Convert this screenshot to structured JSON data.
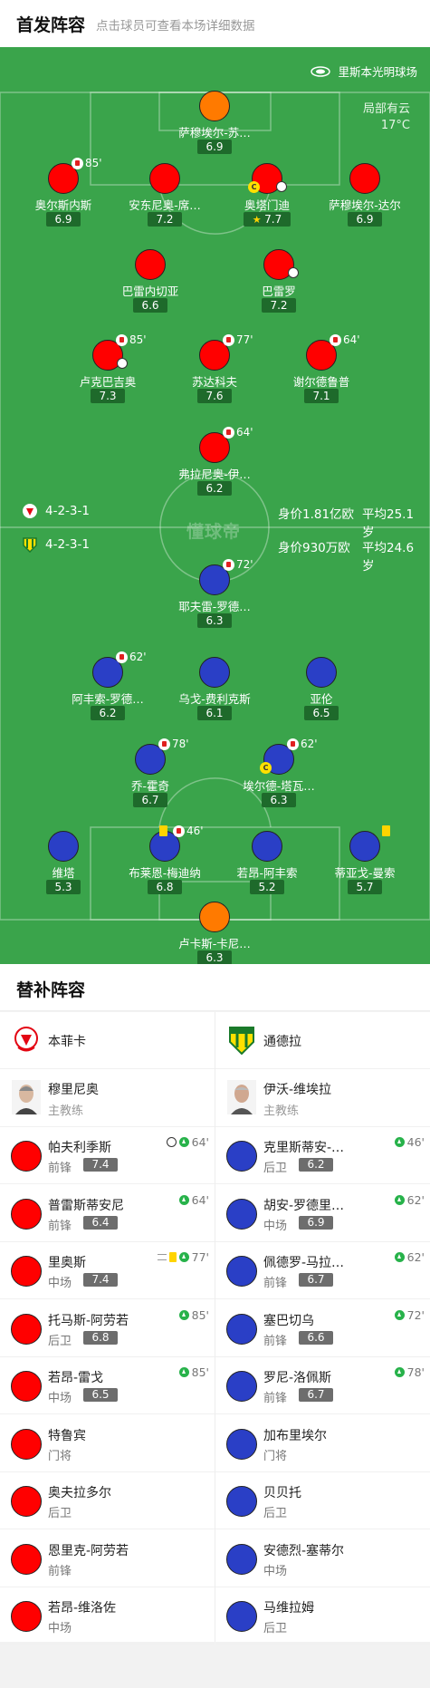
{
  "header": {
    "title": "首发阵容",
    "subtitle": "点击球员可查看本场详细数据"
  },
  "pitch": {
    "venue": "里斯本光明球场",
    "weather": "局部有云",
    "temperature": "17°C",
    "watermark": "懂球帝",
    "home_info": {
      "formation": "4-2-3-1",
      "value": "身价1.81亿欧",
      "avg_age": "平均25.1岁"
    },
    "away_info": {
      "formation": "4-2-3-1",
      "value": "身价930万欧",
      "avg_age": "平均24.6岁"
    }
  },
  "chart_data": {
    "type": "table",
    "home_lineup": [
      {
        "name": "萨穆埃尔-苏…",
        "rating": "6.9",
        "kit": "orange",
        "sub": "",
        "captain": false,
        "ball": false,
        "star": false,
        "card": false
      },
      {
        "name": "奥尔斯内斯",
        "rating": "6.9",
        "kit": "red",
        "sub": "85'",
        "captain": false,
        "ball": false,
        "star": false,
        "card": false
      },
      {
        "name": "安东尼奥-席…",
        "rating": "7.2",
        "kit": "red",
        "sub": "",
        "captain": false,
        "ball": false,
        "star": false,
        "card": false
      },
      {
        "name": "奥塔门迪",
        "rating": "7.7",
        "kit": "red",
        "sub": "",
        "captain": true,
        "ball": true,
        "star": true,
        "card": false
      },
      {
        "name": "萨穆埃尔-达尔",
        "rating": "6.9",
        "kit": "red",
        "sub": "",
        "captain": false,
        "ball": false,
        "star": false,
        "card": false
      },
      {
        "name": "巴雷内切亚",
        "rating": "6.6",
        "kit": "red",
        "sub": "",
        "captain": false,
        "ball": false,
        "star": false,
        "card": false
      },
      {
        "name": "巴雷罗",
        "rating": "7.2",
        "kit": "red",
        "sub": "",
        "captain": false,
        "ball": true,
        "star": false,
        "card": false
      },
      {
        "name": "卢克巴吉奥",
        "rating": "7.3",
        "kit": "red",
        "sub": "85'",
        "captain": false,
        "ball": true,
        "star": false,
        "card": false
      },
      {
        "name": "苏达科夫",
        "rating": "7.6",
        "kit": "red",
        "sub": "77'",
        "captain": false,
        "ball": false,
        "star": false,
        "card": false
      },
      {
        "name": "谢尔德鲁普",
        "rating": "7.1",
        "kit": "red",
        "sub": "64'",
        "captain": false,
        "ball": false,
        "star": false,
        "card": false
      },
      {
        "name": "弗拉尼奥-伊…",
        "rating": "6.2",
        "kit": "red",
        "sub": "64'",
        "captain": false,
        "ball": false,
        "star": false,
        "card": false
      }
    ],
    "away_lineup": [
      {
        "name": "耶夫雷-罗德…",
        "rating": "6.3",
        "kit": "blue",
        "sub": "72'",
        "captain": false,
        "ball": false,
        "star": false,
        "card": false
      },
      {
        "name": "阿丰索-罗德…",
        "rating": "6.2",
        "kit": "blue",
        "sub": "62'",
        "captain": false,
        "ball": false,
        "star": false,
        "card": false
      },
      {
        "name": "乌戈-费利克斯",
        "rating": "6.1",
        "kit": "blue",
        "sub": "",
        "captain": false,
        "ball": false,
        "star": false,
        "card": false
      },
      {
        "name": "亚伦",
        "rating": "6.5",
        "kit": "blue",
        "sub": "",
        "captain": false,
        "ball": false,
        "star": false,
        "card": false
      },
      {
        "name": "乔-霍奇",
        "rating": "6.7",
        "kit": "blue",
        "sub": "78'",
        "captain": false,
        "ball": false,
        "star": false,
        "card": false
      },
      {
        "name": "埃尔德-塔瓦…",
        "rating": "6.3",
        "kit": "blue",
        "sub": "62'",
        "captain": true,
        "ball": false,
        "star": false,
        "card": false
      },
      {
        "name": "维塔",
        "rating": "5.3",
        "kit": "blue",
        "sub": "",
        "captain": false,
        "ball": false,
        "star": false,
        "card": false
      },
      {
        "name": "布莱恩-梅迪纳",
        "rating": "6.8",
        "kit": "blue",
        "sub": "46'",
        "captain": false,
        "ball": false,
        "star": false,
        "card": true
      },
      {
        "name": "若昂-阿丰索",
        "rating": "5.2",
        "kit": "blue",
        "sub": "",
        "captain": false,
        "ball": false,
        "star": false,
        "card": false
      },
      {
        "name": "蒂亚戈-曼索",
        "rating": "5.7",
        "kit": "blue",
        "sub": "",
        "captain": false,
        "ball": false,
        "star": false,
        "card": true
      },
      {
        "name": "卢卡斯-卡尼…",
        "rating": "6.3",
        "kit": "orange",
        "sub": "",
        "captain": false,
        "ball": false,
        "star": false,
        "card": false
      }
    ]
  },
  "subs": {
    "title": "替补阵容",
    "home": {
      "team": "本菲卡",
      "coach": {
        "name": "穆里尼奥",
        "role": "主教练"
      },
      "players": [
        {
          "name": "帕夫利季斯",
          "pos": "前锋",
          "rating": "7.4",
          "time": "64'",
          "ball": true,
          "card": false,
          "swap": false
        },
        {
          "name": "普雷斯蒂安尼",
          "pos": "前锋",
          "rating": "6.4",
          "time": "64'",
          "ball": false,
          "card": false,
          "swap": false
        },
        {
          "name": "里奥斯",
          "pos": "中场",
          "rating": "7.4",
          "time": "77'",
          "ball": false,
          "card": true,
          "swap": true
        },
        {
          "name": "托马斯-阿劳若",
          "pos": "后卫",
          "rating": "6.8",
          "time": "85'",
          "ball": false,
          "card": false,
          "swap": false
        },
        {
          "name": "若昂-雷戈",
          "pos": "中场",
          "rating": "6.5",
          "time": "85'",
          "ball": false,
          "card": false,
          "swap": false
        },
        {
          "name": "特鲁宾",
          "pos": "门将",
          "rating": "",
          "time": "",
          "ball": false,
          "card": false,
          "swap": false
        },
        {
          "name": "奥夫拉多尔",
          "pos": "后卫",
          "rating": "",
          "time": "",
          "ball": false,
          "card": false,
          "swap": false
        },
        {
          "name": "恩里克-阿劳若",
          "pos": "前锋",
          "rating": "",
          "time": "",
          "ball": false,
          "card": false,
          "swap": false
        },
        {
          "name": "若昂-维洛佐",
          "pos": "中场",
          "rating": "",
          "time": "",
          "ball": false,
          "card": false,
          "swap": false
        }
      ]
    },
    "away": {
      "team": "通德拉",
      "coach": {
        "name": "伊沃-维埃拉",
        "role": "主教练"
      },
      "players": [
        {
          "name": "克里斯蒂安-…",
          "pos": "后卫",
          "rating": "6.2",
          "time": "46'",
          "ball": false,
          "card": false,
          "swap": false
        },
        {
          "name": "胡安-罗德里…",
          "pos": "中场",
          "rating": "6.9",
          "time": "62'",
          "ball": false,
          "card": false,
          "swap": false
        },
        {
          "name": "佩德罗-马拉…",
          "pos": "前锋",
          "rating": "6.7",
          "time": "62'",
          "ball": false,
          "card": false,
          "swap": false
        },
        {
          "name": "塞巴切乌",
          "pos": "前锋",
          "rating": "6.6",
          "time": "72'",
          "ball": false,
          "card": false,
          "swap": false
        },
        {
          "name": "罗尼-洛佩斯",
          "pos": "前锋",
          "rating": "6.7",
          "time": "78'",
          "ball": false,
          "card": false,
          "swap": false
        },
        {
          "name": "加布里埃尔",
          "pos": "门将",
          "rating": "",
          "time": "",
          "ball": false,
          "card": false,
          "swap": false
        },
        {
          "name": "贝贝托",
          "pos": "后卫",
          "rating": "",
          "time": "",
          "ball": false,
          "card": false,
          "swap": false
        },
        {
          "name": "安德烈-塞蒂尔",
          "pos": "中场",
          "rating": "",
          "time": "",
          "ball": false,
          "card": false,
          "swap": false
        },
        {
          "name": "马维拉姆",
          "pos": "后卫",
          "rating": "",
          "time": "",
          "ball": false,
          "card": false,
          "swap": false
        }
      ]
    }
  },
  "colors": {
    "pitch": "#3aa44b",
    "home": "#ff0000",
    "away": "#2a3fc6",
    "keeper": "#ff7a00"
  }
}
